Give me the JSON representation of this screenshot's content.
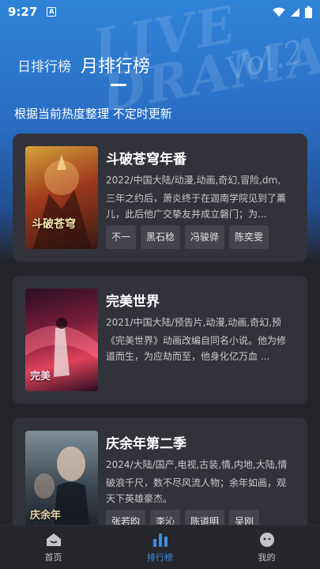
{
  "status": {
    "time": "9:27",
    "notif": "A"
  },
  "header": {
    "tab_day": "日排行榜",
    "tab_month": "月排行榜",
    "subtitle": "根据当前热度整理 不定时更新",
    "watermark": "LIVE\nDRAMA",
    "watermark2": "Vol.2"
  },
  "cards": [
    {
      "title": "斗破苍穹年番",
      "meta": "2022/中国大陆/动漫,动画,奇幻,冒险,dm,",
      "desc": "三年之约后，萧炎终于在迦南学院见到了薰儿，此后他广交挚友并成立磐门；为...",
      "tags": [
        "不一",
        "黑石稔",
        "冯骏骅",
        "陈奕雯"
      ],
      "poster_text": "斗破苍穹",
      "colors": [
        "#d4a23a",
        "#a03a1e",
        "#3a1a12"
      ]
    },
    {
      "title": "完美世界",
      "meta": "2021/中国大陆/预告片,动漫,动画,奇幻,预",
      "desc": "《完美世界》动画改编自同名小说。他为修道而生，为应劫而至，他身化亿万血 ...",
      "tags": [],
      "poster_text": "完美",
      "colors": [
        "#e0415a",
        "#7a1d3a",
        "#2a0e22"
      ]
    },
    {
      "title": "庆余年第二季",
      "meta": "2024/大陆/国产,电视,古装,情,内地,大陆,情",
      "desc": "破浪千尺，数不尽风流人物；余年如画，观天下英雄豪杰。",
      "tags": [
        "张若昀",
        "李沁",
        "陈道明",
        "吴刚"
      ],
      "poster_text": "庆余年",
      "colors": [
        "#7d8f99",
        "#3a4650",
        "#1a2026"
      ]
    }
  ],
  "nav": {
    "home": "首页",
    "rank": "排行榜",
    "mine": "我的"
  },
  "accent": "#3a8ee6"
}
